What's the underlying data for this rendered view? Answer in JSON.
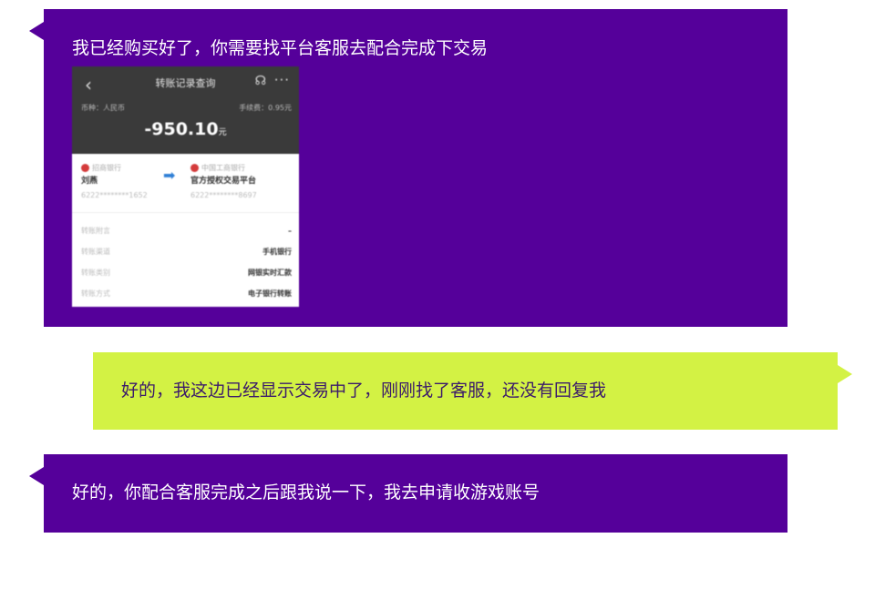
{
  "messages": [
    {
      "side": "left",
      "text": "我已经购买好了，你需要找平台客服去配合完成下交易",
      "receipt": {
        "title": "转账记录查询",
        "currency": "币种：人民币",
        "fee": "手续费：0.95元",
        "amount": "-950.10",
        "amount_unit": "元",
        "from_bank": "招商银行",
        "from_name": "刘燕",
        "from_account": "6222********1652",
        "to_bank": "中国工商银行",
        "to_name": "官方授权交易平台",
        "to_account": "6222********8697",
        "rows": [
          {
            "label": "转账附言",
            "value": "–"
          },
          {
            "label": "转账渠道",
            "value": "手机银行"
          },
          {
            "label": "转账类别",
            "value": "网银实时汇款"
          },
          {
            "label": "转账方式",
            "value": "电子银行转账"
          }
        ]
      }
    },
    {
      "side": "right",
      "text": "好的，我这边已经显示交易中了，刚刚找了客服，还没有回复我"
    },
    {
      "side": "left",
      "text": "好的，你配合客服完成之后跟我说一下，我去申请收游戏账号"
    }
  ],
  "colors": {
    "left_bubble": "#55009a",
    "right_bubble": "#d3f244"
  },
  "icons": [
    "back-arrow-icon",
    "headset-icon",
    "more-icon",
    "bank-logo-icon",
    "transfer-arrow-icon"
  ]
}
